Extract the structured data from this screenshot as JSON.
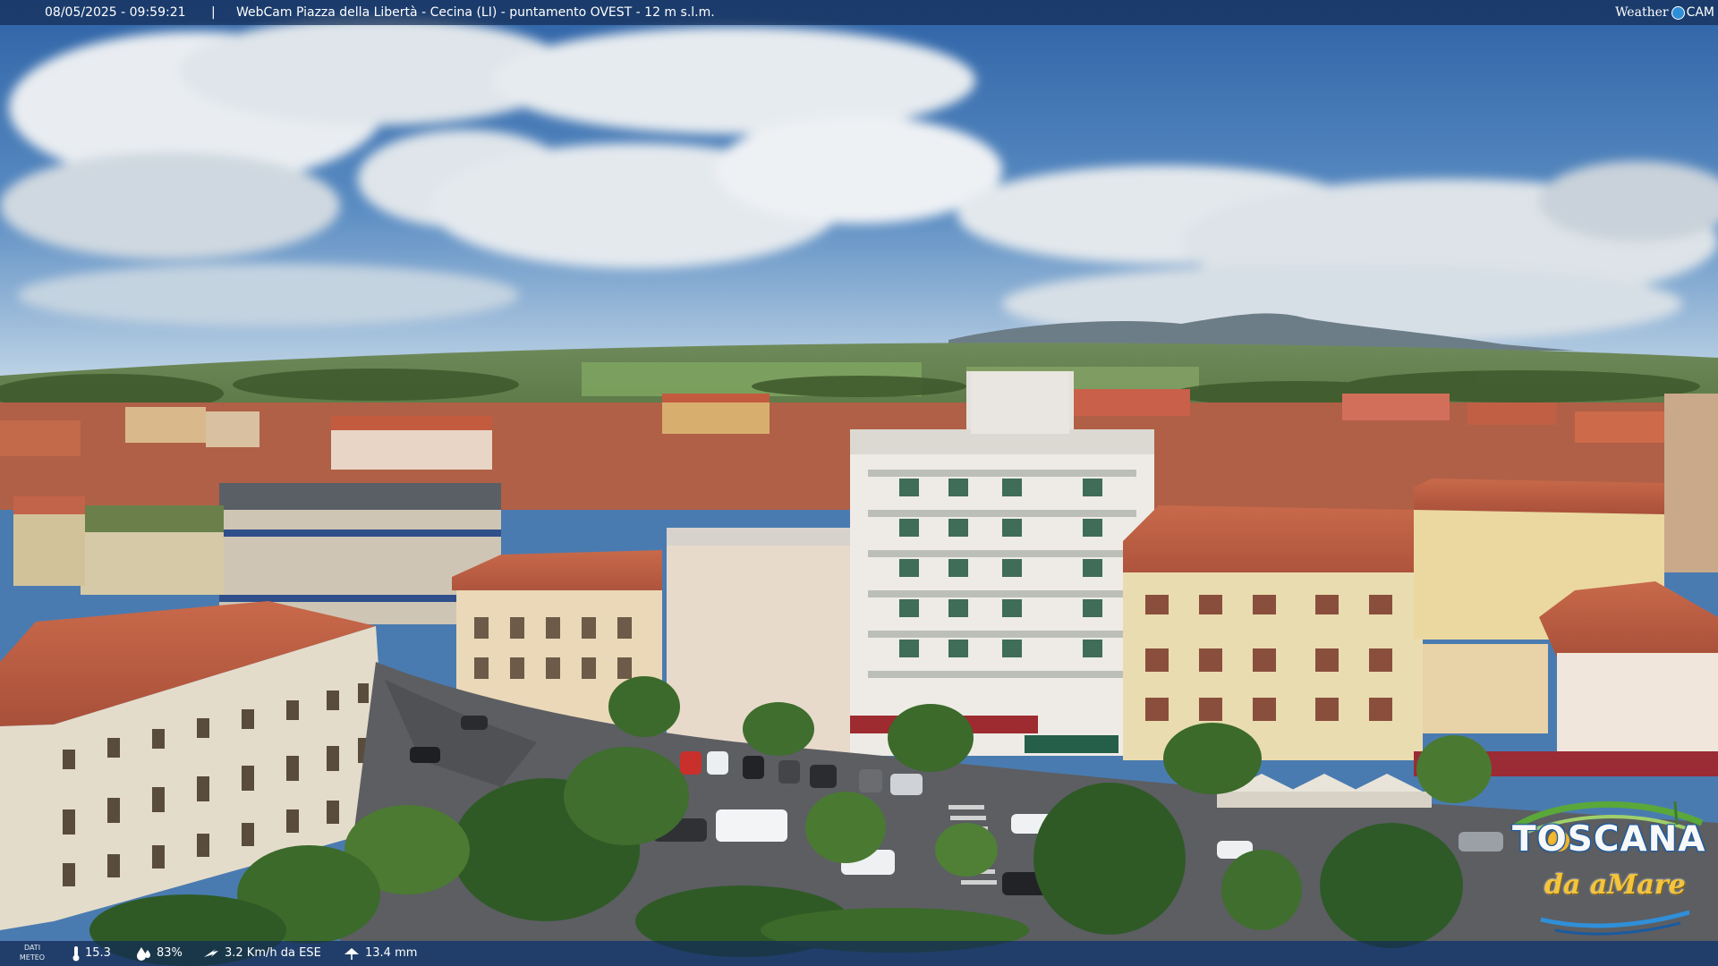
{
  "overlay": {
    "timestamp": "08/05/2025 - 09:59:21",
    "separator": "|",
    "caption": "WebCam Piazza della Libertà - Cecina (LI) - puntamento OVEST - 12 m s.l.m.",
    "brand_weather": "Weather",
    "brand_cam": "CAM"
  },
  "meteo": {
    "label_line1": "DATI",
    "label_line2": "METEO",
    "temperature": "15.3",
    "humidity": "83%",
    "wind": "3.2 Km/h da ESE",
    "rain": "13.4 mm"
  },
  "logo": {
    "title": "TOSCANA",
    "subtitle": "da aMare"
  },
  "icons": {
    "temperature": "thermometer-icon",
    "humidity": "droplet-icon",
    "wind": "wind-icon",
    "rain": "rain-icon"
  },
  "colors": {
    "sky_top": "#2f63a5",
    "sky_horizon": "#b9cfe2",
    "roof": "#b85a3e",
    "overlay_bar": "#142d55",
    "logo_yellow": "#f4c43a",
    "logo_blue": "#1a5aa0"
  }
}
